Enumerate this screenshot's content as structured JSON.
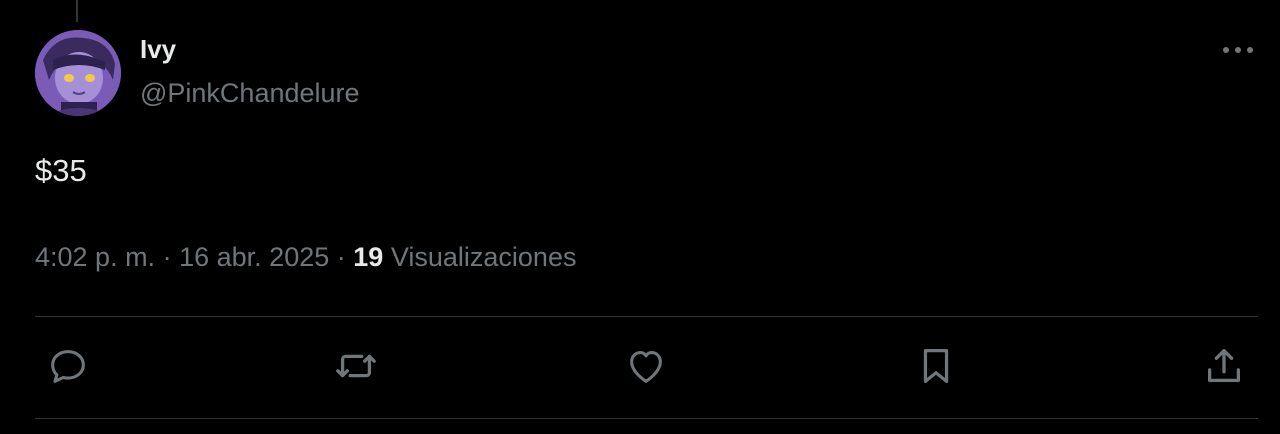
{
  "tweet": {
    "author": {
      "display_name": "Ivy",
      "handle": "@PinkChandelure"
    },
    "text": "$35",
    "meta": {
      "time": "4:02 p. m.",
      "separator": "·",
      "date": "16 abr. 2025",
      "views_count": "19",
      "views_label": "Visualizaciones"
    },
    "actions": [
      {
        "name": "reply",
        "icon": "reply-icon"
      },
      {
        "name": "retweet",
        "icon": "retweet-icon"
      },
      {
        "name": "like",
        "icon": "heart-icon"
      },
      {
        "name": "bookmark",
        "icon": "bookmark-icon"
      },
      {
        "name": "share",
        "icon": "share-icon"
      }
    ]
  },
  "colors": {
    "background": "#000000",
    "primary_text": "#e7e9ea",
    "secondary_text": "#71767b",
    "divider": "#2f3336"
  }
}
